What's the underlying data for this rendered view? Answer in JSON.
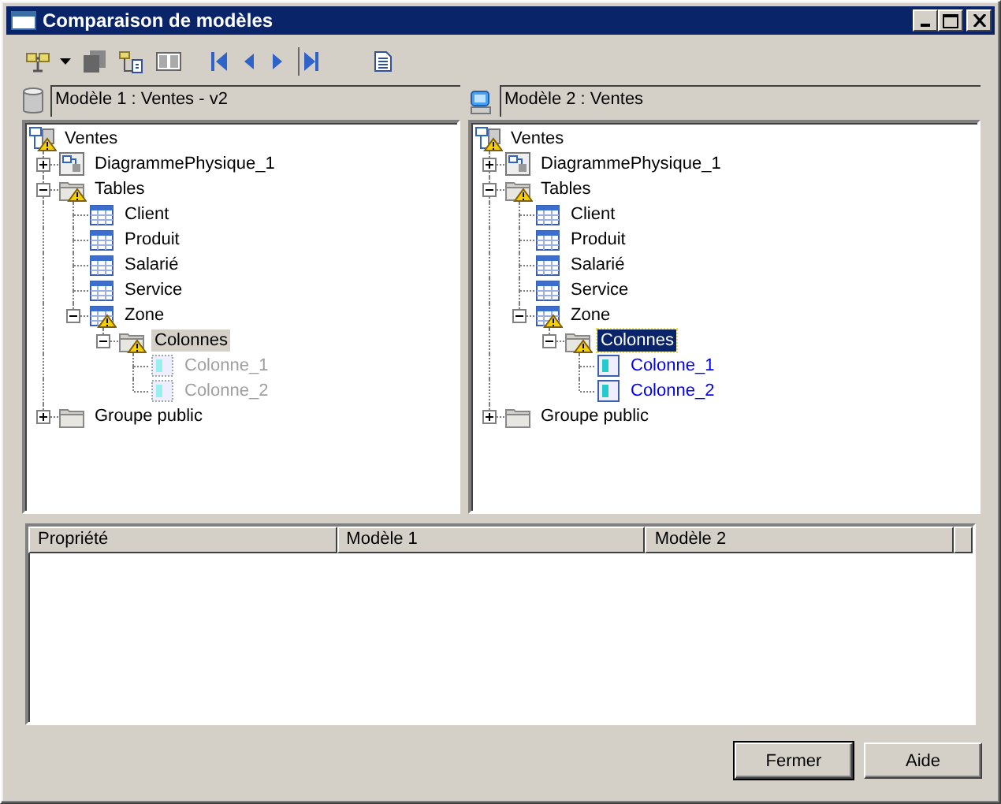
{
  "window": {
    "title": "Comparaison de modèles"
  },
  "models": [
    {
      "label": "Modèle 1 : Ventes - v2",
      "kind": "database",
      "focused": false,
      "tree": [
        {
          "label": "Ventes",
          "kind": "model",
          "warning": true,
          "selected": false,
          "children": [
            {
              "label": "DiagrammePhysique_1",
              "kind": "diagram",
              "warning": false,
              "expanded": false,
              "selected": false
            },
            {
              "label": "Tables",
              "kind": "folder",
              "warning": true,
              "expanded": true,
              "selected": false,
              "children": [
                {
                  "label": "Client",
                  "kind": "table",
                  "warning": false,
                  "selected": false
                },
                {
                  "label": "Produit",
                  "kind": "table",
                  "warning": false,
                  "selected": false
                },
                {
                  "label": "Salarié",
                  "kind": "table",
                  "warning": false,
                  "selected": false
                },
                {
                  "label": "Service",
                  "kind": "table",
                  "warning": false,
                  "selected": false
                },
                {
                  "label": "Zone",
                  "kind": "table",
                  "warning": true,
                  "expanded": true,
                  "selected": false,
                  "children": [
                    {
                      "label": "Colonnes",
                      "kind": "folder",
                      "warning": true,
                      "expanded": true,
                      "selected": true,
                      "children": [
                        {
                          "label": "Colonne_1",
                          "kind": "column",
                          "warning": false,
                          "selected": false,
                          "missing": true,
                          "added": false
                        },
                        {
                          "label": "Colonne_2",
                          "kind": "column",
                          "warning": false,
                          "selected": false,
                          "missing": true,
                          "added": false
                        }
                      ]
                    }
                  ]
                }
              ]
            },
            {
              "label": "Groupe public",
              "kind": "folder",
              "warning": false,
              "expanded": false,
              "selected": false
            }
          ]
        }
      ]
    },
    {
      "label": "Modèle 2 : Ventes",
      "kind": "workstation",
      "focused": true,
      "tree": [
        {
          "label": "Ventes",
          "kind": "model",
          "warning": true,
          "selected": false,
          "children": [
            {
              "label": "DiagrammePhysique_1",
              "kind": "diagram",
              "warning": false,
              "expanded": false,
              "selected": false
            },
            {
              "label": "Tables",
              "kind": "folder",
              "warning": true,
              "expanded": true,
              "selected": false,
              "children": [
                {
                  "label": "Client",
                  "kind": "table",
                  "warning": false,
                  "selected": false
                },
                {
                  "label": "Produit",
                  "kind": "table",
                  "warning": false,
                  "selected": false
                },
                {
                  "label": "Salarié",
                  "kind": "table",
                  "warning": false,
                  "selected": false
                },
                {
                  "label": "Service",
                  "kind": "table",
                  "warning": false,
                  "selected": false
                },
                {
                  "label": "Zone",
                  "kind": "table",
                  "warning": true,
                  "expanded": true,
                  "selected": false,
                  "children": [
                    {
                      "label": "Colonnes",
                      "kind": "folder",
                      "warning": true,
                      "expanded": true,
                      "selected": true,
                      "children": [
                        {
                          "label": "Colonne_1",
                          "kind": "column",
                          "warning": false,
                          "selected": false,
                          "missing": false,
                          "added": true
                        },
                        {
                          "label": "Colonne_2",
                          "kind": "column",
                          "warning": false,
                          "selected": false,
                          "missing": false,
                          "added": true
                        }
                      ]
                    }
                  ]
                }
              ]
            },
            {
              "label": "Groupe public",
              "kind": "folder",
              "warning": false,
              "expanded": false,
              "selected": false
            }
          ]
        }
      ]
    }
  ],
  "table": {
    "columns": [
      "Propriété",
      "Modèle 1",
      "Modèle 2"
    ]
  },
  "buttons": [
    {
      "label": "Fermer",
      "default": true
    },
    {
      "label": "Aide",
      "default": false
    }
  ]
}
